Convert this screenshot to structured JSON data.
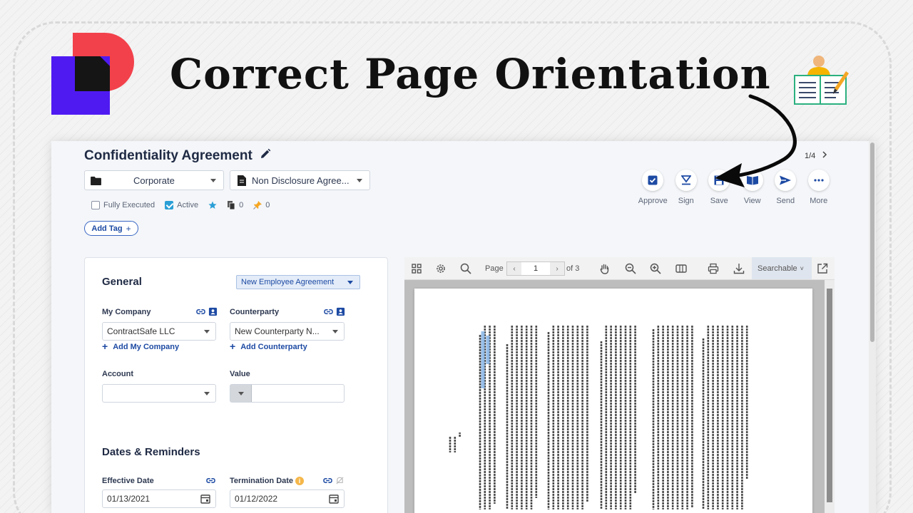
{
  "banner": {
    "headline": "Correct Page Orientation"
  },
  "header": {
    "title": "Confidentiality Agreement",
    "folder_select": "Corporate",
    "type_select": "Non Disclosure Agree...",
    "fully_executed_label": "Fully Executed",
    "active_label": "Active",
    "docs_count": "0",
    "pins_count": "0",
    "add_tag_label": "Add Tag",
    "pager": "1/4"
  },
  "actions": [
    {
      "label": "Approve"
    },
    {
      "label": "Sign"
    },
    {
      "label": "Save"
    },
    {
      "label": "View"
    },
    {
      "label": "Send"
    },
    {
      "label": "More"
    }
  ],
  "general": {
    "title": "General",
    "template_select": "New Employee Agreement",
    "my_company_label": "My Company",
    "my_company_value": "ContractSafe LLC",
    "add_my_company": "Add My Company",
    "counterparty_label": "Counterparty",
    "counterparty_value": "New Counterparty N...",
    "add_counterparty": "Add Counterparty",
    "account_label": "Account",
    "account_value": "",
    "value_label": "Value",
    "value_value": ""
  },
  "dates": {
    "title": "Dates & Reminders",
    "effective_label": "Effective Date",
    "effective_value": "01/13/2021",
    "termination_label": "Termination Date",
    "termination_value": "01/12/2022"
  },
  "viewer": {
    "page_label": "Page",
    "page_value": "1",
    "of_label": "of 3",
    "searchable_label": "Searchable"
  },
  "colors": {
    "accent": "#1d4aa3",
    "brand_red": "#f2414b",
    "brand_blue": "#4f1af2",
    "checked": "#2a9fd6"
  }
}
